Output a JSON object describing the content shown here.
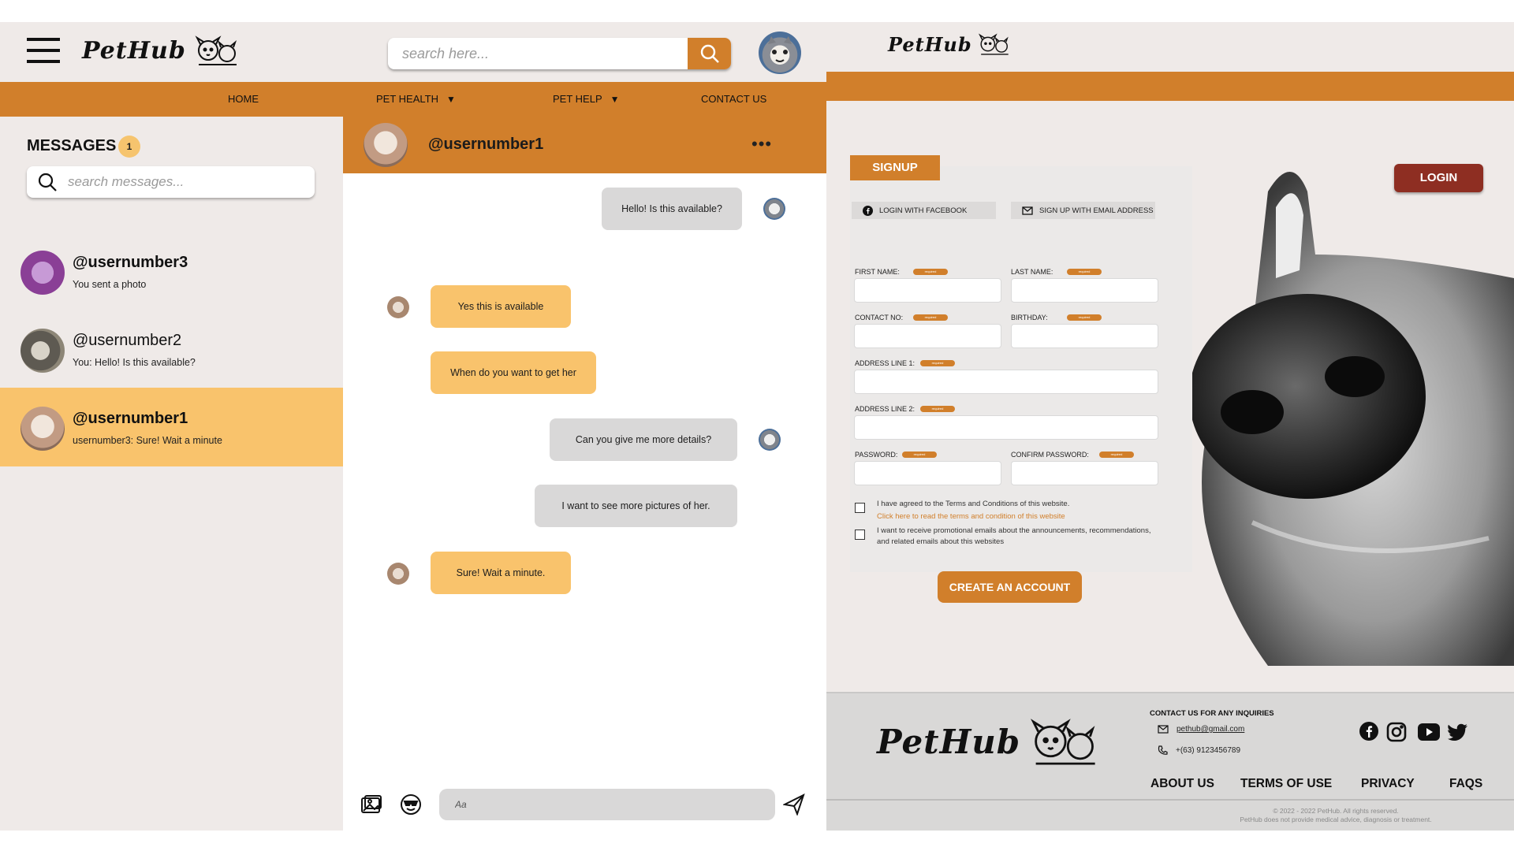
{
  "brand": {
    "name": "PetHub",
    "accent": "#d17f2b",
    "highlight": "#f9c36c",
    "dark_red": "#8e2e22"
  },
  "chat_app": {
    "topbar": {
      "logo_text": "PetHub",
      "search_placeholder": "search here...",
      "menu_icon": "hamburger-icon",
      "search_icon": "search-icon"
    },
    "nav": [
      {
        "label": "HOME",
        "dropdown": false
      },
      {
        "label": "PET HEALTH",
        "dropdown": true
      },
      {
        "label": "PET HELP",
        "dropdown": true
      },
      {
        "label": "CONTACT US",
        "dropdown": false
      }
    ],
    "sidebar": {
      "title": "MESSAGES",
      "badge": "1",
      "search_placeholder": "search messages...",
      "conversations": [
        {
          "name": "@usernumber3",
          "preview": "You sent a photo",
          "active": false,
          "bold": true
        },
        {
          "name": "@usernumber2",
          "preview": "You: Hello! Is this available?",
          "active": false,
          "bold": false
        },
        {
          "name": "@usernumber1",
          "preview": "usernumber3: Sure! Wait a minute",
          "active": true,
          "bold": true
        }
      ]
    },
    "chat": {
      "username": "@usernumber1",
      "more_label": "•••",
      "messages": [
        {
          "from": "me",
          "text": "Hello! Is this available?"
        },
        {
          "from": "them",
          "text": "Yes this is available"
        },
        {
          "from": "them",
          "text": "When do you want to get her"
        },
        {
          "from": "me",
          "text": "Can you give me more details?"
        },
        {
          "from": "me",
          "text": "I want to see more pictures of her."
        },
        {
          "from": "them",
          "text": "Sure! Wait a minute."
        }
      ],
      "composer_placeholder": "Aa"
    }
  },
  "signup_app": {
    "logo_text": "PetHub",
    "signup_tab": "SIGNUP",
    "login_button": "LOGIN",
    "facebook_button": "LOGIN WITH FACEBOOK",
    "email_button": "SIGN UP WITH EMAIL ADDRESS",
    "required_tag": "required",
    "fields": {
      "first_name": "FIRST NAME:",
      "last_name": "LAST NAME:",
      "contact_no": "CONTACT NO:",
      "birthday": "BIRTHDAY:",
      "address1": "ADDRESS LINE 1:",
      "address2": "ADDRESS LINE 2:",
      "password": "PASSWORD:",
      "confirm_password": "CONFIRM PASSWORD:"
    },
    "terms_text": "I have agreed to the Terms and Conditions of this website.",
    "terms_link": "Click here to read the terms and condition of this website",
    "promo_text_1": "I want to receive promotional emails about the announcements, recommendations,",
    "promo_text_2": "and related emails about this websites",
    "create_button": "CREATE AN ACCOUNT",
    "footer": {
      "logo_text": "PetHub",
      "contact_heading": "CONTACT US FOR ANY INQUIRIES",
      "email": "pethub@gmail.com",
      "phone": "+(63) 9123456789",
      "links": [
        "ABOUT US",
        "TERMS OF USE",
        "PRIVACY",
        "FAQS"
      ],
      "social": [
        "facebook-icon",
        "instagram-icon",
        "youtube-icon",
        "twitter-icon"
      ],
      "copyright_1": "© 2022 - 2022 PetHub. All rights reserved.",
      "copyright_2": "PetHub does not provide medical advice, diagnosis or treatment."
    }
  }
}
